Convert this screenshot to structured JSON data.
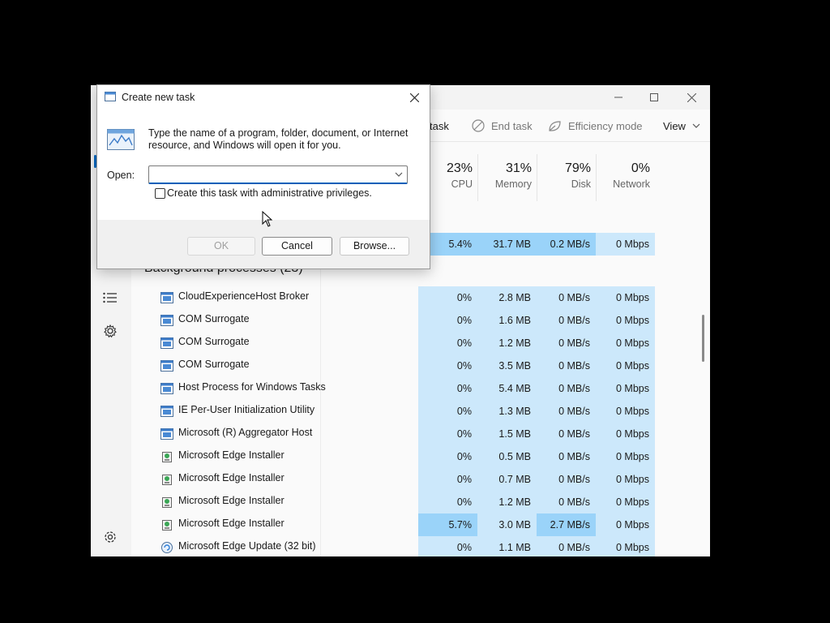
{
  "task_manager": {
    "window_controls": {
      "minimize": "—",
      "maximize": "☐",
      "close": "✕"
    },
    "toolbar": {
      "run_task_label": "task",
      "end_task_label": "End task",
      "efficiency_label": "Efficiency mode",
      "view_label": "View"
    },
    "columns": {
      "cpu": {
        "pct": "23%",
        "name": "CPU"
      },
      "memory": {
        "pct": "31%",
        "name": "Memory"
      },
      "disk": {
        "pct": "79%",
        "name": "Disk"
      },
      "network": {
        "pct": "0%",
        "name": "Network"
      }
    },
    "app_row": {
      "cpu": "5.4%",
      "memory": "31.7 MB",
      "disk": "0.2 MB/s",
      "network": "0 Mbps"
    },
    "group_label": "Background processes (23)",
    "processes": [
      {
        "name": "CloudExperienceHost Broker",
        "cpu": "0%",
        "memory": "2.8 MB",
        "disk": "0 MB/s",
        "network": "0 Mbps"
      },
      {
        "name": "COM Surrogate",
        "cpu": "0%",
        "memory": "1.6 MB",
        "disk": "0 MB/s",
        "network": "0 Mbps"
      },
      {
        "name": "COM Surrogate",
        "cpu": "0%",
        "memory": "1.2 MB",
        "disk": "0 MB/s",
        "network": "0 Mbps"
      },
      {
        "name": "COM Surrogate",
        "cpu": "0%",
        "memory": "3.5 MB",
        "disk": "0 MB/s",
        "network": "0 Mbps"
      },
      {
        "name": "Host Process for Windows Tasks",
        "cpu": "0%",
        "memory": "5.4 MB",
        "disk": "0 MB/s",
        "network": "0 Mbps"
      },
      {
        "name": "IE Per-User Initialization Utility",
        "cpu": "0%",
        "memory": "1.3 MB",
        "disk": "0 MB/s",
        "network": "0 Mbps"
      },
      {
        "name": "Microsoft (R) Aggregator Host",
        "cpu": "0%",
        "memory": "1.5 MB",
        "disk": "0 MB/s",
        "network": "0 Mbps"
      },
      {
        "name": "Microsoft Edge Installer",
        "cpu": "0%",
        "memory": "0.5 MB",
        "disk": "0 MB/s",
        "network": "0 Mbps"
      },
      {
        "name": "Microsoft Edge Installer",
        "cpu": "0%",
        "memory": "0.7 MB",
        "disk": "0 MB/s",
        "network": "0 Mbps"
      },
      {
        "name": "Microsoft Edge Installer",
        "cpu": "0%",
        "memory": "1.2 MB",
        "disk": "0 MB/s",
        "network": "0 Mbps"
      },
      {
        "name": "Microsoft Edge Installer",
        "cpu": "5.7%",
        "memory": "3.0 MB",
        "disk": "2.7 MB/s",
        "network": "0 Mbps"
      },
      {
        "name": "Microsoft Edge Update (32 bit)",
        "cpu": "0%",
        "memory": "1.1 MB",
        "disk": "0 MB/s",
        "network": "0 Mbps"
      }
    ],
    "process_icons": [
      "app-window-icon",
      "app-window-icon",
      "app-window-icon",
      "app-window-icon",
      "app-window-icon",
      "app-window-icon",
      "app-window-icon",
      "installer-icon",
      "installer-icon",
      "installer-icon",
      "installer-icon",
      "update-icon"
    ]
  },
  "dialog": {
    "title": "Create new task",
    "message": "Type the name of a program, folder, document, or Internet resource, and Windows will open it for you.",
    "open_label": "Open:",
    "open_value": "",
    "admin_checkbox_label": "Create this task with administrative privileges.",
    "admin_checked": false,
    "ok_label": "OK",
    "cancel_label": "Cancel",
    "browse_label": "Browse..."
  },
  "colors": {
    "heat_low": "#cce8fb",
    "heat_high": "#9ad3f9",
    "accent": "#0067c0"
  }
}
